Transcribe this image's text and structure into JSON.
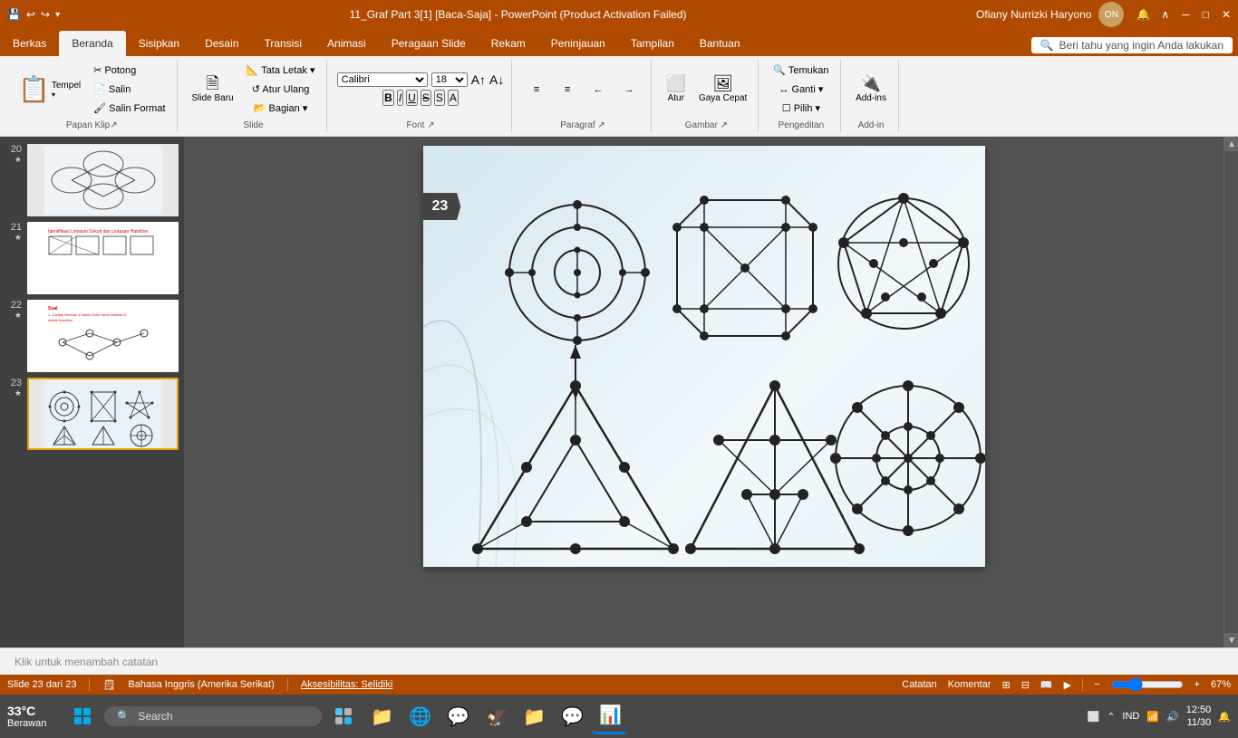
{
  "titlebar": {
    "title": "11_Graf Part 3[1] [Baca-Saja] - PowerPoint (Product Activation Failed)",
    "user": "Ofiany Nurrizki Haryono",
    "min": "─",
    "max": "□",
    "close": "✕",
    "save_icon": "💾",
    "undo_icon": "↩",
    "redo_icon": "↪"
  },
  "ribbon": {
    "tabs": [
      "Beranda",
      "Sisipkan",
      "Desain",
      "Transisi",
      "Animasi",
      "Peragaan Slide",
      "Rekam",
      "Peninjauan",
      "Tampilan",
      "Bantuan"
    ],
    "active_tab": "Beranda",
    "search_placeholder": "Beri tahu yang ingin Anda lakukan",
    "groups": [
      {
        "label": "Papan Klip",
        "buttons": [
          "Tempel",
          "Slide Baru"
        ]
      },
      {
        "label": "Slide",
        "buttons": [
          "Tata Letak",
          "Atur Ulang",
          "Bagian"
        ]
      },
      {
        "label": "Font",
        "buttons": [
          "B",
          "I",
          "U",
          "S",
          "A"
        ]
      },
      {
        "label": "Paragraf",
        "buttons": [
          "≡",
          "≡",
          "≡"
        ]
      },
      {
        "label": "Gambar",
        "buttons": [
          "Atur",
          "Gaya Cepat"
        ]
      },
      {
        "label": "Pengeditan",
        "buttons": [
          "Temukan",
          "Ganti",
          "Pilih"
        ]
      },
      {
        "label": "Add-in",
        "buttons": [
          "Add-ins",
          "Add-in"
        ]
      }
    ]
  },
  "slides": [
    {
      "num": "20",
      "star": "★",
      "active": false,
      "label": "Slide 20"
    },
    {
      "num": "21",
      "star": "★",
      "active": false,
      "label": "Slide 21"
    },
    {
      "num": "22",
      "star": "★",
      "active": false,
      "label": "Slide 22"
    },
    {
      "num": "23",
      "star": "★",
      "active": true,
      "label": "Slide 23"
    }
  ],
  "current_slide": {
    "number": "23",
    "badge_num": "23"
  },
  "notes": {
    "placeholder": "Klik untuk menambah catatan"
  },
  "statusbar": {
    "slide_info": "Slide 23 dari 23",
    "language": "Bahasa Inggris (Amerika Serikat)",
    "accessibility": "Aksesibilitas: Selidiki",
    "notes_label": "Catatan",
    "comments_label": "Komentar",
    "zoom": "67%"
  },
  "taskbar": {
    "search_label": "Search",
    "search_icon": "🔍",
    "time": "12:50",
    "date": "11/30",
    "language_indicator": "IND",
    "icons": [
      "🪟",
      "🔍",
      "📁",
      "🌐",
      "💬",
      "🦅",
      "📁",
      "🍃",
      "📊"
    ]
  },
  "weather": {
    "temp": "33°C",
    "condition": "Berawan"
  }
}
